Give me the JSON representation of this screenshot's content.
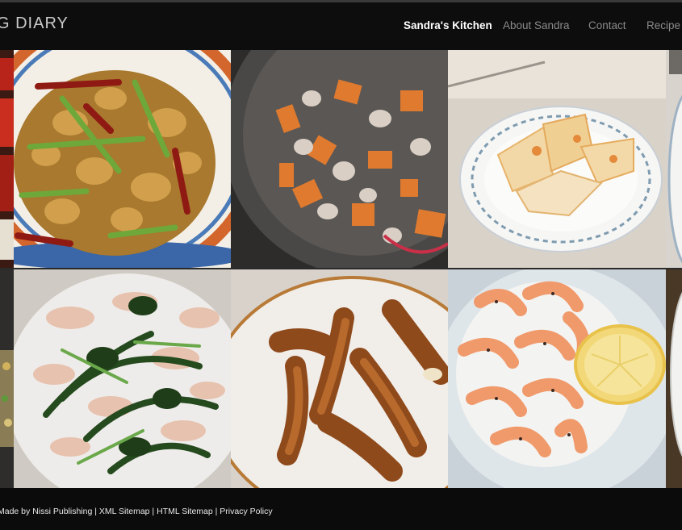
{
  "header": {
    "logo_text": "G DIARY",
    "nav": [
      {
        "label": "Sandra's Kitchen",
        "active": true
      },
      {
        "label": "About Sandra",
        "active": false
      },
      {
        "label": "Contact",
        "active": false
      },
      {
        "label": "Recipe I",
        "active": false
      }
    ]
  },
  "gallery": {
    "tiles": [
      {
        "name": "partial-left-top",
        "subject": "tomato dish (partially visible)"
      },
      {
        "name": "kung-pao-chicken",
        "subject": "stir-fried chicken with chilies and scallions"
      },
      {
        "name": "chicken-carrot-stirfry",
        "subject": "diced chicken with carrots in a wok"
      },
      {
        "name": "quesadilla",
        "subject": "cut quesadilla wedges on a plate"
      },
      {
        "name": "partial-right-top",
        "subject": "plate edge (partially visible)"
      },
      {
        "name": "partial-left-bottom",
        "subject": "dish (partially visible)"
      },
      {
        "name": "chicken-spinach-stirfry",
        "subject": "shredded chicken with spinach"
      },
      {
        "name": "fried-pork-strips",
        "subject": "fried crispy strips"
      },
      {
        "name": "garlic-shrimp",
        "subject": "sauteed shrimp with lemon wedge"
      },
      {
        "name": "partial-right-bottom",
        "subject": "plate edge (partially visible)"
      }
    ]
  },
  "footer": {
    "made_by": "Made by Nissi Publishing",
    "sep1": " | ",
    "xml_sitemap": "XML Sitemap",
    "sep2": " | ",
    "html_sitemap": "HTML Sitemap",
    "sep3": " | ",
    "privacy": "Privacy Policy"
  }
}
